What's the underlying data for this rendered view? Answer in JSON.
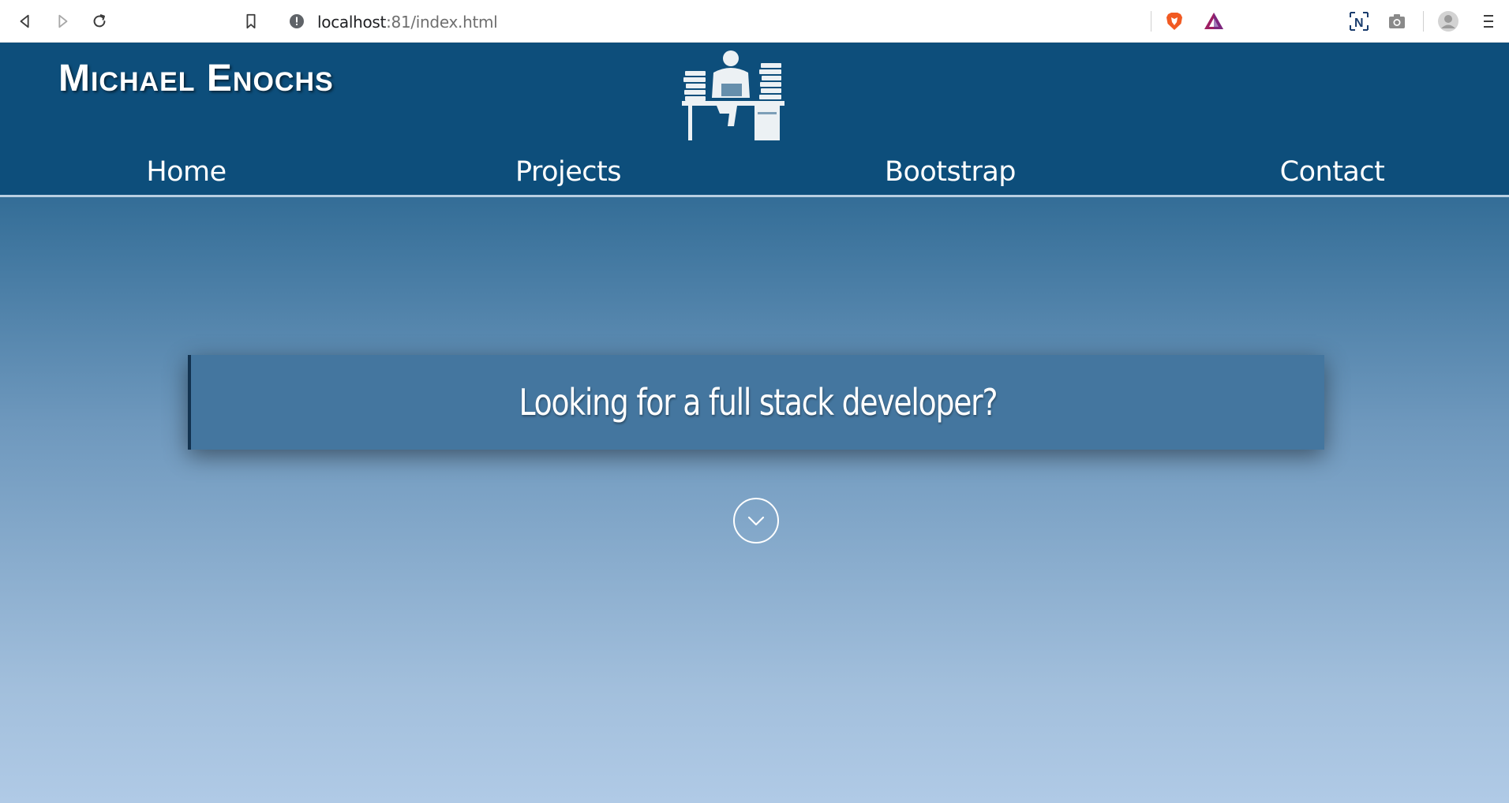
{
  "browser": {
    "url_host": "localhost",
    "url_path": ":81/index.html",
    "icons": [
      "back-icon",
      "forward-icon",
      "reload-icon",
      "bookmark-icon",
      "site-info-icon",
      "brave-shields-icon",
      "brave-rewards-icon",
      "extension-n-icon",
      "screenshot-icon",
      "profile-icon",
      "menu-icon"
    ]
  },
  "site": {
    "brand": "Michael Enochs",
    "nav": [
      {
        "label": "Home"
      },
      {
        "label": "Projects"
      },
      {
        "label": "Bootstrap"
      },
      {
        "label": "Contact"
      }
    ],
    "hero": {
      "tagline": "Looking for a full stack developer?"
    }
  },
  "colors": {
    "header_bg": "#0d4e7b",
    "tagline_bg": "#44769f",
    "gradient_top": "#1b5786",
    "gradient_bottom": "#b0cae6"
  }
}
